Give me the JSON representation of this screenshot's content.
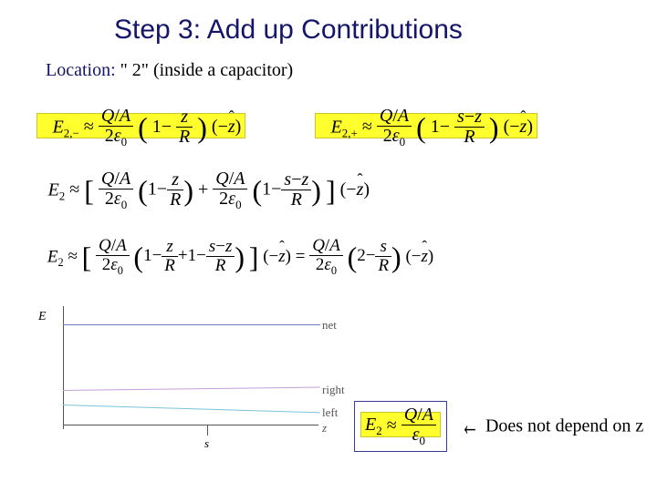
{
  "title": "Step 3: Add up Contributions",
  "location": {
    "label": "Location:",
    "value": "\" 2\" (inside a capacitor)"
  },
  "sym": {
    "approx": "≈",
    "Q": "Q",
    "A": "A",
    "over": "/",
    "two": "2",
    "eps0": "ε",
    "eps0_sub": "0",
    "one": "1",
    "minus": "−",
    "plus": "+",
    "z": "z",
    "R": "R",
    "s": "s",
    "eq": "=",
    "mzhat_open": "(−",
    "mzhat_close": ")",
    "zhat": "z",
    "arrow_left": "←"
  },
  "labels": {
    "E": "E",
    "sub_2m": "2,−",
    "sub_2p": "2,+",
    "sub_2": "2"
  },
  "graph": {
    "ylabel": "E",
    "net": "net",
    "right": "right",
    "left": "left",
    "zlabel": "z",
    "slabel": "s"
  },
  "final": {
    "note": "Does not depend on z"
  }
}
